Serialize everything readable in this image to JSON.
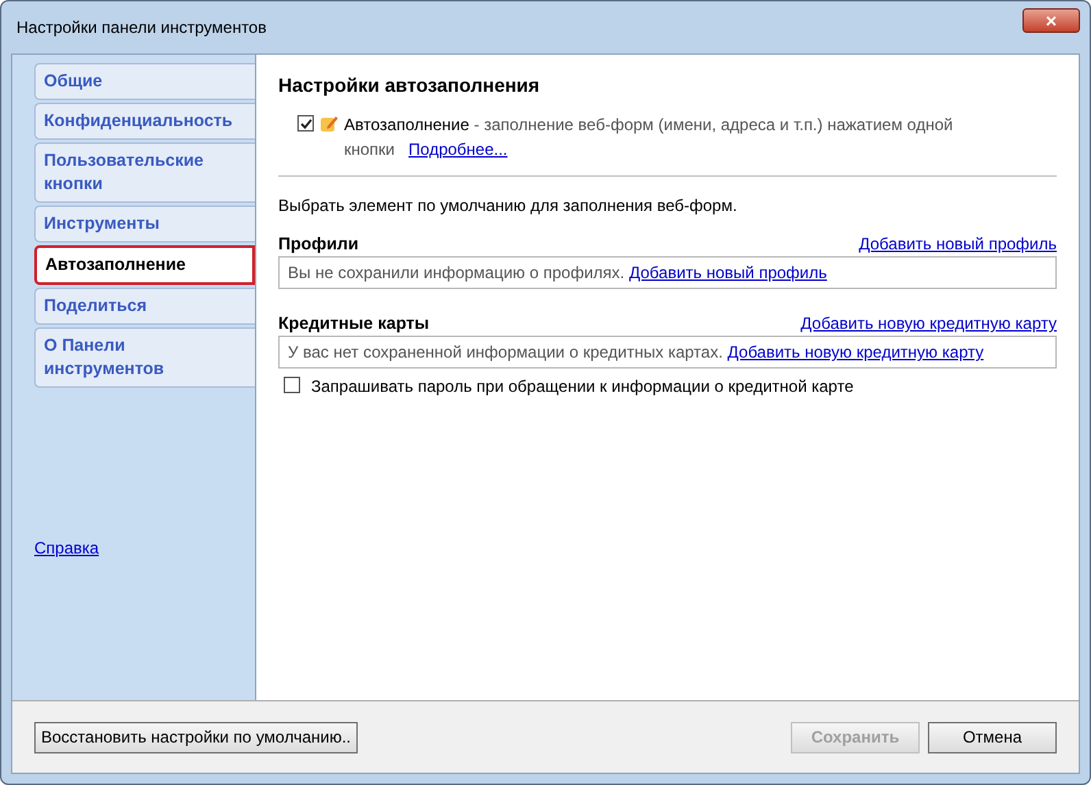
{
  "window": {
    "title": "Настройки панели инструментов",
    "close": "×"
  },
  "sidebar": {
    "items": [
      {
        "label": "Общие",
        "selected": false
      },
      {
        "label": "Конфиденциальность",
        "selected": false
      },
      {
        "label": "Пользовательские кнопки",
        "selected": false
      },
      {
        "label": "Инструменты",
        "selected": false
      },
      {
        "label": "Автозаполнение",
        "selected": true
      },
      {
        "label": "Поделиться",
        "selected": false
      },
      {
        "label": "О Панели инструментов",
        "selected": false
      }
    ],
    "help_link": "Справка"
  },
  "content": {
    "heading": "Настройки автозаполнения",
    "autofill": {
      "checked": true,
      "title": "Автозаполнение",
      "description": " - заполнение веб-форм (имени, адреса и т.п.) нажатием одной кнопки",
      "more_link": "Подробнее..."
    },
    "intro": "Выбрать элемент по умолчанию для заполнения веб-форм.",
    "sections": [
      {
        "title": "Профили",
        "add_link": "Добавить новый профиль",
        "empty_text": "Вы не сохранили информацию о профилях.",
        "inline_link": "Добавить новый профиль"
      },
      {
        "title": "Кредитные карты",
        "add_link": "Добавить новую кредитную карту",
        "empty_text": "У вас нет сохраненной информации о кредитных картах.",
        "inline_link": "Добавить новую кредитную карту"
      }
    ],
    "password_option": {
      "label": "Запрашивать пароль при обращении к информации о кредитной карте",
      "checked": false
    }
  },
  "footer": {
    "reset_button": "Восстановить настройки по умолчанию..",
    "buttons": [
      {
        "label": "Сохранить",
        "disabled": true
      },
      {
        "label": "Отмена",
        "disabled": false
      }
    ]
  }
}
